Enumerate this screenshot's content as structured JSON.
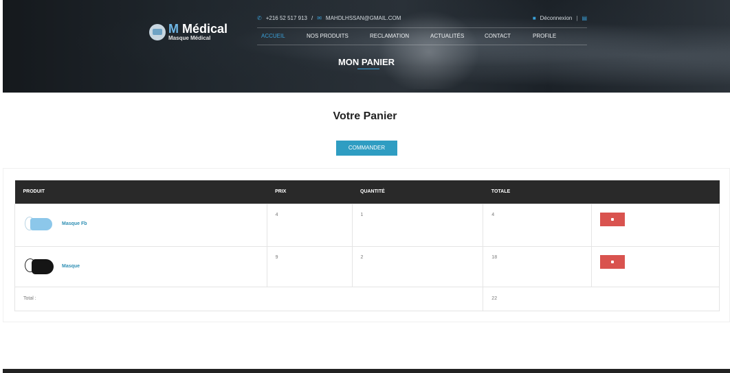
{
  "brand": {
    "title_m": "M",
    "title_rest": " Médical",
    "subtitle": "Masque Médical",
    "accent_color": "#3aa0d8"
  },
  "topbar": {
    "phone": "+216 52 517 913",
    "separator": "/",
    "email": "MAHDLHSSAN@GMAIL.COM",
    "logout": "Déconnexion",
    "pipe": "|",
    "phone_icon": "phone-icon",
    "mail_icon": "mail-icon",
    "lock_icon": "lock-icon",
    "cart_icon": "cart-icon"
  },
  "nav": {
    "items": [
      {
        "label": "ACCUEIL",
        "active": true
      },
      {
        "label": "NOS PRODUITS"
      },
      {
        "label": "RECLAMATION"
      },
      {
        "label": "ACTUALITÉS"
      },
      {
        "label": "CONTACT"
      },
      {
        "label": "PROFILE"
      }
    ]
  },
  "hero": {
    "title": "MON PANIER"
  },
  "main": {
    "title": "Votre Panier",
    "commander_label": "COMMANDER",
    "commander_color": "#2f9dc2"
  },
  "cart": {
    "headers": [
      "PRODUIT",
      "PRIX",
      "QUANTITÉ",
      "TOTALE",
      ""
    ],
    "rows": [
      {
        "name": "Masque Fb",
        "prix": "4",
        "quantite": "1",
        "totale": "4",
        "image": "blue-mask-image"
      },
      {
        "name": "Masque",
        "prix": "9",
        "quantite": "2",
        "totale": "18",
        "image": "black-mask-image"
      }
    ],
    "total_label": "Total :",
    "total_value": "22",
    "delete_color": "#d9534f",
    "delete_icon": "trash-icon"
  }
}
